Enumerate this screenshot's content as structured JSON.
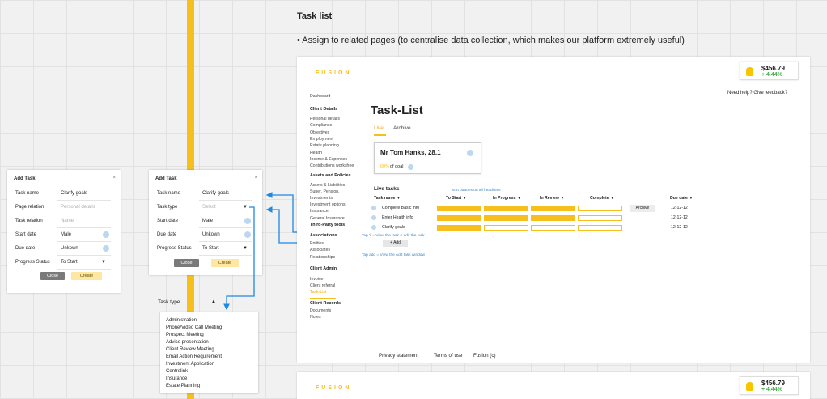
{
  "canvas": {
    "title": "Task list",
    "bullet": "• Assign to related pages (to centralise data collection, which makes our platform extremely useful)"
  },
  "modal_left": {
    "title": "Add Task",
    "close_x": "×",
    "rows": [
      {
        "label": "Task name",
        "value": "Clarify goals",
        "placeholder": false
      },
      {
        "label": "Page relation",
        "value": "Personal details",
        "placeholder": true
      },
      {
        "label": "Task relation",
        "value": "Name",
        "placeholder": true
      },
      {
        "label": "Start date",
        "value": "Male",
        "placeholder": false
      },
      {
        "label": "Due date",
        "value": "Unkown",
        "placeholder": false
      },
      {
        "label": "Progress Status",
        "value": "To Start",
        "placeholder": false
      }
    ],
    "caret": "▼",
    "close_label": "Close",
    "create_label": "Create"
  },
  "modal_right": {
    "title": "Add Task",
    "close_x": "×",
    "rows": [
      {
        "label": "Task name",
        "value": "Clarify goals",
        "placeholder": false
      },
      {
        "label": "Task type",
        "value": "Select",
        "placeholder": true
      },
      {
        "label": "Start date",
        "value": "Male",
        "placeholder": false
      },
      {
        "label": "Due date",
        "value": "Unkown",
        "placeholder": false
      },
      {
        "label": "Progress Status",
        "value": "To Start",
        "placeholder": false
      }
    ],
    "caret": "▼",
    "close_label": "Close",
    "create_label": "Create"
  },
  "task_type_dropdown": {
    "label": "Task type",
    "caret": "▲",
    "options": [
      "Administration",
      "Phone/Video Call Meeting",
      "Prospect Meeting",
      "Advice presentation",
      "Client Review Meeting",
      "Email Action Requirement",
      "Investment Application",
      "Centrelink",
      "Insurance",
      "Estate Planning"
    ]
  },
  "app": {
    "logo": "FUSION",
    "balance_amount": "$456.79",
    "balance_change": "+ 4.44%",
    "help": "Need help? Give feedback?",
    "page_title": "Task-List",
    "tabs": {
      "live": "Live",
      "archive": "Archive"
    },
    "client": {
      "name": "Mr Tom Hanks, 28.1",
      "goal_pct": "60%",
      "goal_text": "of goal"
    },
    "live_heading": "Live tasks",
    "sort_note": "Sort buttons on all headlines",
    "columns": [
      "Task name ▼",
      "To Start ▼",
      "In Progress ▼",
      "In Review ▼",
      "Complete ▼",
      "Due date ▼"
    ],
    "tasks": [
      {
        "name": "Complete Basic info",
        "progress": 3,
        "due": "12-12-12"
      },
      {
        "name": "Enter Health info",
        "progress": 3,
        "due": "12-12-12"
      },
      {
        "name": "Clarify goals",
        "progress": 1,
        "due": "12-12-12"
      }
    ],
    "archive_label": "Archive",
    "add_label": "+ Add",
    "note_tap_i": "Tap 'i' = View the task & edit the task",
    "note_tap_add": "Tap add = View the Add task window",
    "footer": {
      "privacy": "Privacy statement",
      "terms": "Terms of use",
      "brand": "Fusion (c)"
    }
  },
  "sidebar": {
    "dashboard": "Dashboard",
    "client_details": "Client Details",
    "client_items": [
      "Personal details",
      "Compliance",
      "Objectives",
      "Employment",
      "Estate planning",
      "Health",
      "Income & Expenses",
      "Contributions workshee"
    ],
    "assets_policies": "Assets and Policies",
    "asset_items": [
      "Assets & Liabilities",
      "Super, Pension,",
      "Investments",
      "Investment options",
      "Insurance",
      "General Insurance"
    ],
    "third_party": "Third-Party tools",
    "associations": "Associations",
    "association_items": [
      "Entities",
      "Associates",
      "Relationships"
    ],
    "client_admin": "Client Admin",
    "admin_items": [
      "Invoice",
      "Client referral",
      "Task-List"
    ],
    "client_records": "Client Records",
    "record_items": [
      "Documents",
      "Notes"
    ]
  },
  "colors": {
    "accent": "#f7bf1e",
    "link": "#3a82c4",
    "positive": "#4caf50"
  }
}
